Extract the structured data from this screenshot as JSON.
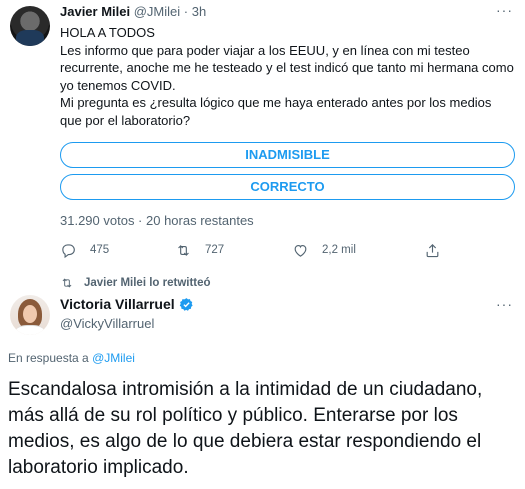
{
  "tweet1": {
    "author_name": "Javier Milei",
    "author_handle": "@JMilei",
    "separator": "·",
    "time": "3h",
    "more": "···",
    "lines": [
      "HOLA A TODOS",
      "Les informo que para poder viajar a los EEUU, y en línea con mi testeo recurrente, anoche me he testeado y el test indicó que tanto mi hermana como yo tenemos COVID.",
      "Mi pregunta es ¿resulta lógico que me haya enterado antes por los medios que por el laboratorio?"
    ],
    "poll_options": [
      "INADMISIBLE",
      "CORRECTO"
    ],
    "poll_meta": "31.290 votos · 20 horas restantes",
    "actions": {
      "replies": "475",
      "retweets": "727",
      "likes": "2,2 mil"
    }
  },
  "retweet_notice": "Javier Milei lo retwitteó",
  "tweet2": {
    "author_name": "Victoria Villarruel",
    "author_handle": "@VickyVillarruel",
    "more": "···",
    "reply_prefix": "En respuesta a",
    "reply_to": "@JMilei",
    "text": "Escandalosa intromisión a la intimidad de un ciudadano, más allá de su rol político y público. Enterarse por los medios, es algo de lo que debiera estar respondiendo el laboratorio implicado."
  },
  "colors": {
    "accent": "#1d9bf0",
    "muted": "#536471",
    "text": "#0f1419"
  }
}
